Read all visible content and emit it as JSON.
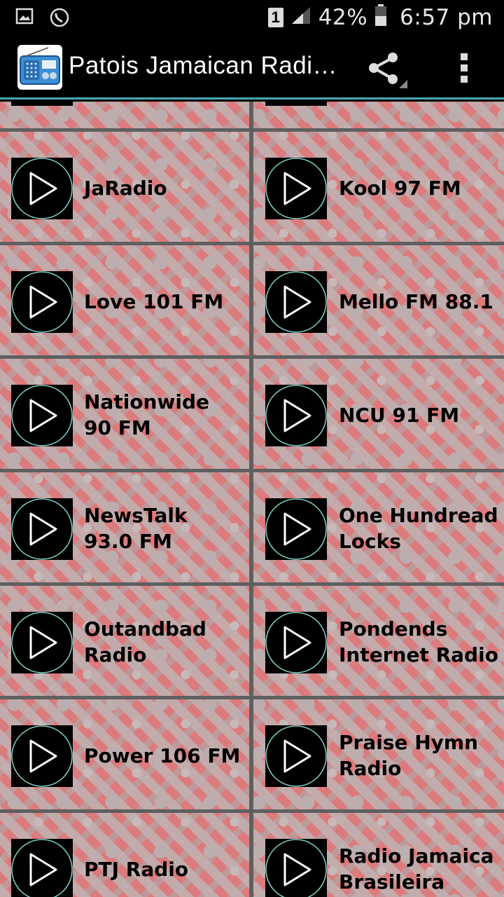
{
  "status_bar": {
    "sim_slot": "1",
    "battery_percent": "42%",
    "time": "6:57 pm"
  },
  "app_bar": {
    "title": "Patois Jamaican Radi…",
    "share_icon": "share-icon",
    "overflow_icon": "overflow-menu-icon"
  },
  "colors": {
    "accent": "#4ba7b5",
    "background": "#dc7b7d",
    "divider": "#5f5f5f"
  },
  "stations": [
    {
      "name": "JaRadio"
    },
    {
      "name": "Kool 97 FM"
    },
    {
      "name": "Love 101 FM"
    },
    {
      "name": "Mello FM 88.1"
    },
    {
      "name": "Nationwide 90 FM"
    },
    {
      "name": "NCU 91 FM"
    },
    {
      "name": "NewsTalk 93.0 FM"
    },
    {
      "name": "One Hundread Locks"
    },
    {
      "name": "Outandbad Radio"
    },
    {
      "name": "Pondends Internet Radio"
    },
    {
      "name": "Power 106 FM"
    },
    {
      "name": "Praise Hymn Radio"
    },
    {
      "name": "PTJ Radio"
    },
    {
      "name": "Radio Jamaica Brasileira"
    }
  ]
}
